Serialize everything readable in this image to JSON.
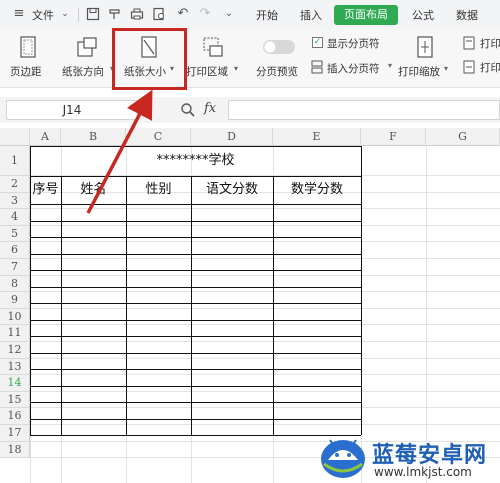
{
  "menubar": {
    "file_label": "文件",
    "tabs": [
      {
        "label": "开始",
        "active": false
      },
      {
        "label": "插入",
        "active": false
      },
      {
        "label": "页面布局",
        "active": true
      },
      {
        "label": "公式",
        "active": false
      },
      {
        "label": "数据",
        "active": false
      }
    ],
    "toolbar_icons": [
      "save-icon",
      "format-painter-icon",
      "print-icon",
      "print-preview-icon",
      "undo-icon",
      "redo-icon",
      "more-icon"
    ],
    "accent_color": "#2faa52"
  },
  "ribbon": {
    "margins": "页边距",
    "orientation": "纸张方向",
    "paper_size": "纸张大小",
    "print_area": "打印区域",
    "page_break_preview": "分页预览",
    "show_page_breaks": "显示分页符",
    "show_page_breaks_checked": true,
    "insert_page_break": "插入分页符",
    "print_scaling": "打印缩放",
    "print_label_1": "打印",
    "print_label_2": "打印"
  },
  "formula": {
    "cell_ref": "J14",
    "fx": "fx"
  },
  "sheet": {
    "columns": [
      "A",
      "B",
      "C",
      "D",
      "E",
      "F",
      "G"
    ],
    "rows": [
      "1",
      "2",
      "3",
      "4",
      "5",
      "6",
      "7",
      "8",
      "9",
      "10",
      "11",
      "12",
      "13",
      "14",
      "15",
      "16",
      "17",
      "18"
    ],
    "active_row": "14",
    "title": "********学校",
    "headers": [
      "序号",
      "姓名",
      "性别",
      "语文分数",
      "数学分数"
    ]
  },
  "watermark": {
    "title": "蓝莓安卓网",
    "url": "www.lmkjst.com"
  },
  "annotation_color": "#c8281f"
}
